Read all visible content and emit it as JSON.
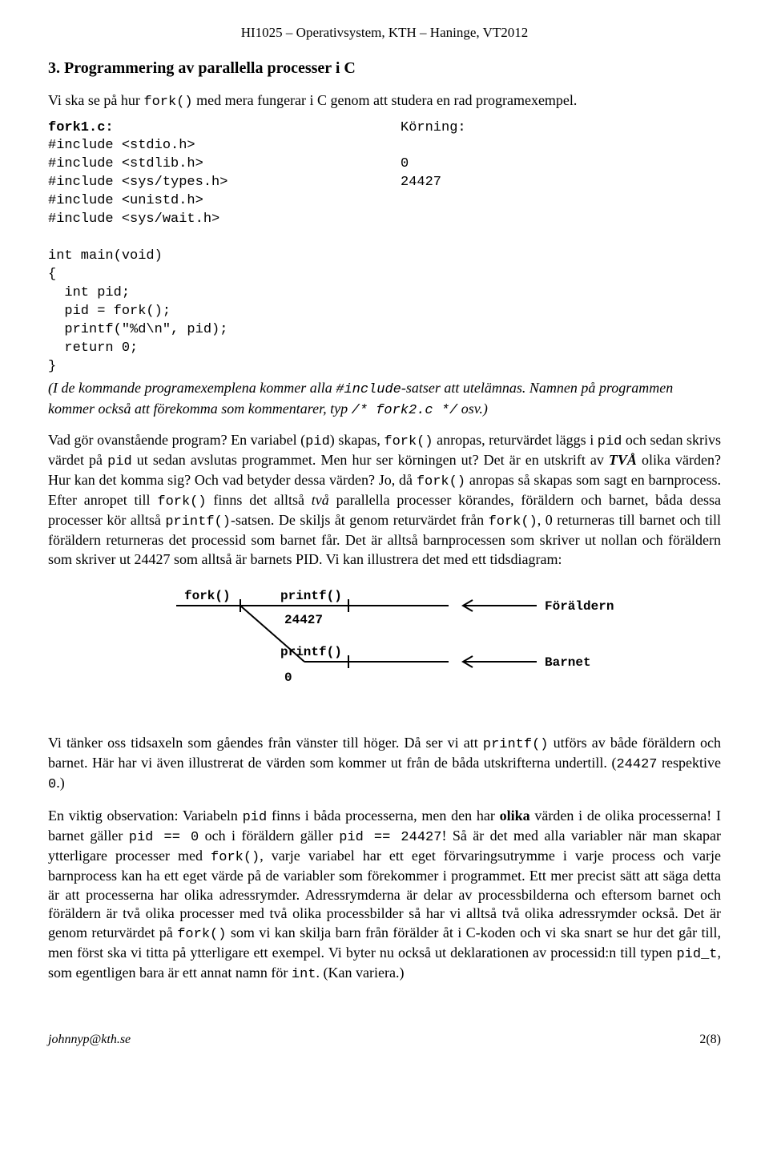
{
  "header": "HI1025 – Operativsystem, KTH – Haninge, VT2012",
  "section_title": "3. Programmering av parallella processer i C",
  "intro_1": "Vi ska se på hur ",
  "intro_code": "fork()",
  "intro_2": " med mera fungerar i C genom att studera en rad programexempel.",
  "code_left_title": "fork1.c:",
  "code_left": "#include <stdio.h>\n#include <stdlib.h>\n#include <sys/types.h>\n#include <unistd.h>\n#include <sys/wait.h>\n\nint main(void)\n{\n  int pid;\n  pid = fork();\n  printf(\"%d\\n\", pid);\n  return 0;\n}",
  "code_right_title": "Körning:",
  "code_right": "\n0\n24427",
  "italic_note_1": "(I de kommande programexemplena kommer alla ",
  "italic_note_code1": "#include",
  "italic_note_2": "-satser att utelämnas. Namnen på programmen kommer också att förekomma som kommentarer, typ ",
  "italic_note_code2": "/* fork2.c */",
  "italic_note_3": " osv.)",
  "para1_a": "Vad gör ovanstående program? En variabel (",
  "para1_code1": "pid",
  "para1_b": ") skapas, ",
  "para1_code2": "fork()",
  "para1_c": " anropas, returvärdet läggs i ",
  "para1_code3": "pid",
  "para1_d": " och sedan skrivs värdet på ",
  "para1_code4": "pid",
  "para1_e": " ut sedan avslutas programmet. Men hur ser körningen ut? Det är en utskrift av ",
  "para1_bold1": "TVÅ",
  "para1_f": " olika värden? Hur kan det komma sig? Och vad betyder dessa värden? Jo, då ",
  "para1_code5": "fork()",
  "para1_g": " anropas så skapas som sagt en barnprocess. Efter anropet till ",
  "para1_code6": "fork()",
  "para1_h": " finns det alltså ",
  "para1_ital1": "två",
  "para1_i": " parallella processer körandes, föräldern och barnet, båda dessa processer kör alltså ",
  "para1_code7": "printf()",
  "para1_j": "-satsen. De skiljs åt genom returvärdet från ",
  "para1_code8": "fork()",
  "para1_k": ", 0 returneras till barnet och till föräldern returneras det processid som barnet får. Det är alltså barnprocessen som skriver ut nollan och föräldern som skriver ut 24427 som alltså är barnets PID. Vi kan illustrera det med ett tidsdiagram:",
  "diagram": {
    "fork_label": "fork()",
    "printf_label": "printf()",
    "parent_label": "Föräldern",
    "child_label": "Barnet",
    "val_parent": "24427",
    "val_child": "0"
  },
  "para2_a": "Vi tänker oss tidsaxeln som gåendes från vänster till höger. Då ser vi att ",
  "para2_code1": "printf()",
  "para2_b": " utförs av både föräldern och barnet. Här har vi även illustrerat de värden som kommer ut från de båda utskrifterna undertill. (",
  "para2_code2": "24427",
  "para2_c": " respektive ",
  "para2_code3": "0",
  "para2_d": ".)",
  "para3_a": "En viktig observation: Variabeln ",
  "para3_code1": "pid",
  "para3_b": " finns i båda processerna, men den har ",
  "para3_bold1": "olika",
  "para3_c": " värden i de olika processerna! I barnet gäller ",
  "para3_code2": "pid == 0",
  "para3_d": " och i föräldern gäller ",
  "para3_code3": "pid == 24427",
  "para3_e": "! Så är det med alla variabler när man skapar ytterligare processer med ",
  "para3_code4": "fork()",
  "para3_f": ", varje variabel har ett eget förvaringsutrymme i varje process och varje barnprocess kan ha ett eget värde på de variabler som förekommer i programmet. Ett mer precist sätt att säga detta är att processerna har olika adressrymder. Adressrymderna är delar av processbilderna och eftersom barnet och föräldern är två olika processer med två olika processbilder så har vi alltså två olika adressrymder också. Det är genom returvärdet på ",
  "para3_code5": "fork()",
  "para3_g": " som vi kan skilja barn från förälder åt i C-koden och vi ska snart se hur det går till, men först ska vi titta på ytterligare ett exempel. Vi byter nu också ut deklarationen av processid:n till typen ",
  "para3_code6": "pid_t",
  "para3_h": ", som egentligen bara är ett annat namn för ",
  "para3_code7": "int",
  "para3_i": ". (Kan variera.)",
  "footer_left": "johnnyp@kth.se",
  "footer_right": "2(8)"
}
